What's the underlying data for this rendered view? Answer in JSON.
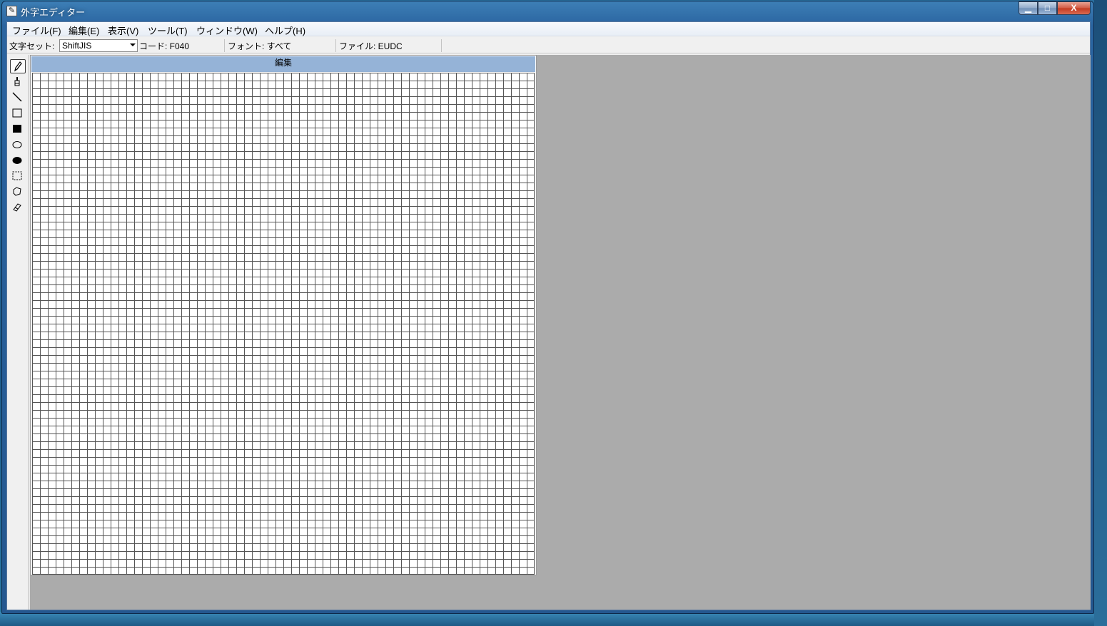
{
  "window": {
    "title": "外字エディター",
    "buttons": {
      "minimize": "▁",
      "maximize": "□",
      "close": "X"
    }
  },
  "menubar": {
    "items": [
      "ファイル(F)",
      "編集(E)",
      "表示(V)",
      "ツール(T)",
      "ウィンドウ(W)",
      "ヘルプ(H)"
    ]
  },
  "toolbar": {
    "charset_label": "文字セット:",
    "charset_value": "ShiftJIS",
    "code": "コード: F040",
    "font": "フォント: すべて",
    "file": "ファイル: EUDC"
  },
  "tools": [
    {
      "name": "pencil-tool",
      "icon": "pencil-icon",
      "active": true
    },
    {
      "name": "brush-tool",
      "icon": "brush-icon",
      "active": false
    },
    {
      "name": "line-tool",
      "icon": "line-icon",
      "active": false
    },
    {
      "name": "hollow-rectangle-tool",
      "icon": "rectangle-outline-icon",
      "active": false
    },
    {
      "name": "filled-rectangle-tool",
      "icon": "rectangle-filled-icon",
      "active": false
    },
    {
      "name": "hollow-ellipse-tool",
      "icon": "ellipse-outline-icon",
      "active": false
    },
    {
      "name": "filled-ellipse-tool",
      "icon": "ellipse-filled-icon",
      "active": false
    },
    {
      "name": "rectangular-selection-tool",
      "icon": "rect-select-icon",
      "active": false
    },
    {
      "name": "freeform-selection-tool",
      "icon": "freeform-select-icon",
      "active": false
    },
    {
      "name": "eraser-tool",
      "icon": "eraser-icon",
      "active": false
    }
  ],
  "editor": {
    "title": "編集",
    "grid_cells": 64
  },
  "colors": {
    "titlebar": "#2a64a0",
    "edit_title": "#95b3d7",
    "workspace": "#ababab"
  }
}
